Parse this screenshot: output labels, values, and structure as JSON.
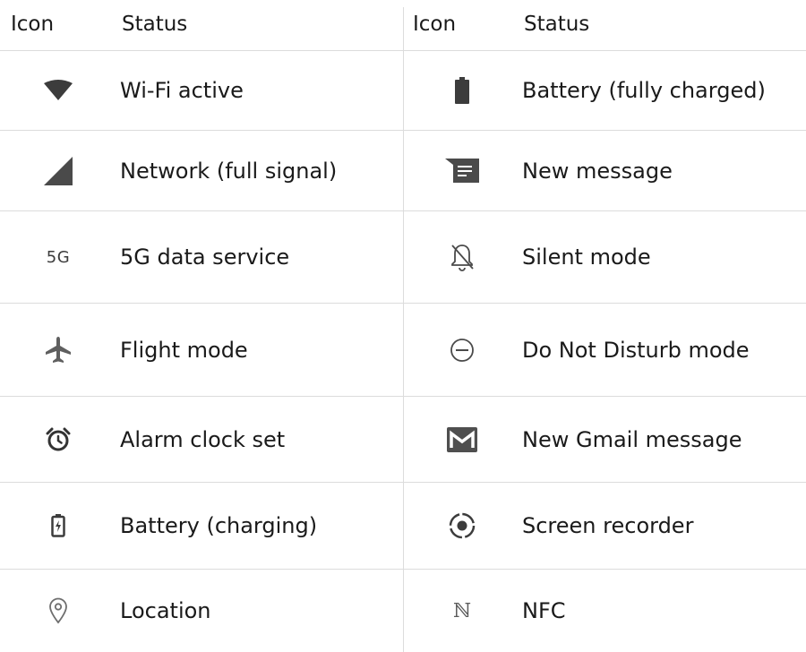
{
  "table": {
    "left": {
      "header": {
        "icon": "Icon",
        "status": "Status"
      },
      "rows": [
        {
          "icon": "wifi-icon",
          "label": "Wi-Fi active"
        },
        {
          "icon": "signal-icon",
          "label": "Network (full signal)"
        },
        {
          "icon": "5g-icon",
          "icon_text": "5G",
          "label": "5G data service"
        },
        {
          "icon": "airplane-icon",
          "label": "Flight mode"
        },
        {
          "icon": "alarm-clock-icon",
          "label": "Alarm clock set"
        },
        {
          "icon": "battery-charging-icon",
          "label": "Battery (charging)"
        },
        {
          "icon": "location-icon",
          "label": "Location"
        }
      ]
    },
    "right": {
      "header": {
        "icon": "Icon",
        "status": "Status"
      },
      "rows": [
        {
          "icon": "battery-full-icon",
          "label": "Battery (fully charged)"
        },
        {
          "icon": "message-icon",
          "label": "New message"
        },
        {
          "icon": "bell-off-icon",
          "label": "Silent mode"
        },
        {
          "icon": "do-not-disturb-icon",
          "label": "Do Not Disturb mode"
        },
        {
          "icon": "gmail-icon",
          "label": "New Gmail message"
        },
        {
          "icon": "screen-recorder-icon",
          "label": "Screen recorder"
        },
        {
          "icon": "nfc-icon",
          "icon_text": "ℕ",
          "label": "NFC"
        }
      ]
    }
  },
  "colors": {
    "icon": "#5f5f5f",
    "icon_dark": "#3c3c3c",
    "divider": "#dcdcdc",
    "text": "#1a1a1a"
  }
}
